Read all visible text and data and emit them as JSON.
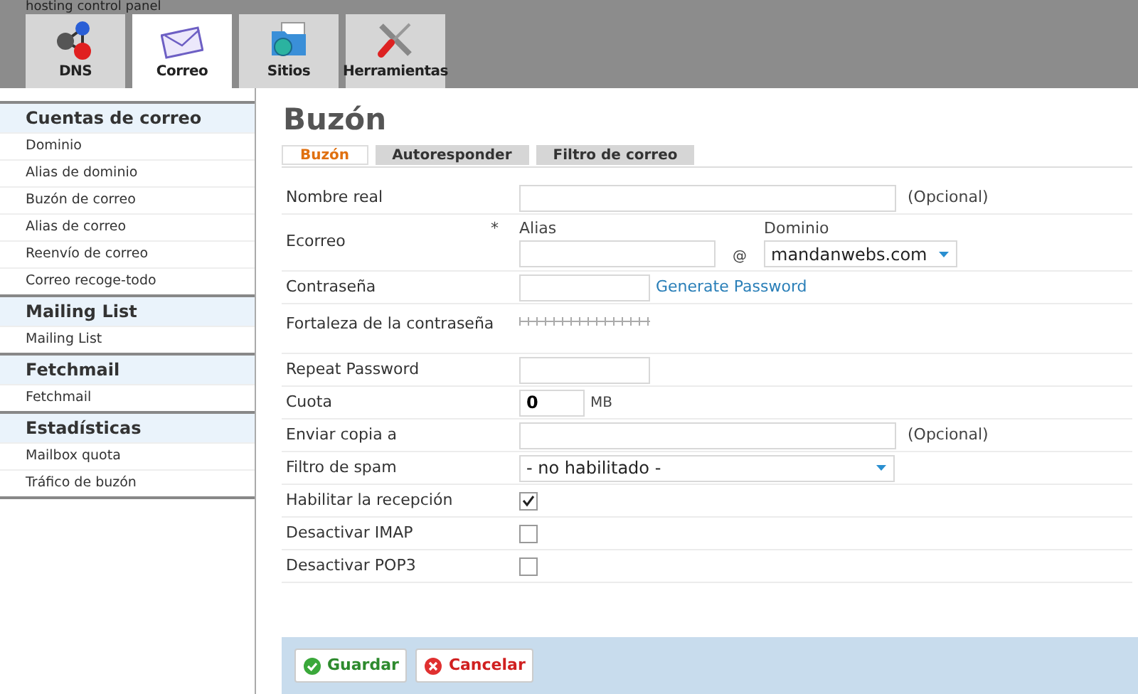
{
  "header": {
    "title": "hosting control panel"
  },
  "main_tabs": [
    {
      "label": "DNS",
      "kind": "dns",
      "selected": false
    },
    {
      "label": "Correo",
      "kind": "mail",
      "selected": true
    },
    {
      "label": "Sitios",
      "kind": "sites",
      "selected": false
    },
    {
      "label": "Herramientas",
      "kind": "tools",
      "selected": false
    }
  ],
  "sidebar": {
    "sections": [
      {
        "title": "Cuentas de correo",
        "items": [
          "Dominio",
          "Alias de dominio",
          "Buzón de correo",
          "Alias de correo",
          "Reenvío de correo",
          "Correo recoge-todo"
        ]
      },
      {
        "title": "Mailing List",
        "items": [
          "Mailing List"
        ]
      },
      {
        "title": "Fetchmail",
        "items": [
          "Fetchmail"
        ]
      },
      {
        "title": "Estadísticas",
        "items": [
          "Mailbox quota",
          "Tráfico de buzón"
        ]
      }
    ]
  },
  "page": {
    "title": "Buzón",
    "tabs": [
      {
        "label": "Buzón",
        "selected": true
      },
      {
        "label": "Autoresponder",
        "selected": false
      },
      {
        "label": "Filtro de correo",
        "selected": false
      }
    ],
    "fields": [
      {
        "kind": "text",
        "label": "Nombre real",
        "note": "(Opcional)"
      },
      {
        "kind": "email",
        "label": "Ecorreo",
        "required_mark": "*",
        "alias_label": "Alias",
        "at": "@",
        "domain_label": "Dominio",
        "domain_value": "mandanwebs.com"
      },
      {
        "kind": "password",
        "label": "Contraseña",
        "link": "Generate Password"
      },
      {
        "kind": "strength",
        "label": "Fortaleza de la contraseña"
      },
      {
        "kind": "short",
        "label": "Repeat Password"
      },
      {
        "kind": "quota",
        "label": "Cuota",
        "value": "0",
        "unit": "MB"
      },
      {
        "kind": "text",
        "label": "Enviar copia a",
        "note": "(Opcional)"
      },
      {
        "kind": "select",
        "label": "Filtro de spam",
        "value": "- no habilitado -"
      },
      {
        "kind": "checkbox",
        "label": "Habilitar la recepción",
        "checked": true
      },
      {
        "kind": "checkbox",
        "label": "Desactivar IMAP",
        "checked": false
      },
      {
        "kind": "checkbox",
        "label": "Desactivar POP3",
        "checked": false
      }
    ],
    "buttons": [
      {
        "label": "Guardar",
        "kind": "save"
      },
      {
        "label": "Cancelar",
        "kind": "cancel"
      }
    ]
  }
}
